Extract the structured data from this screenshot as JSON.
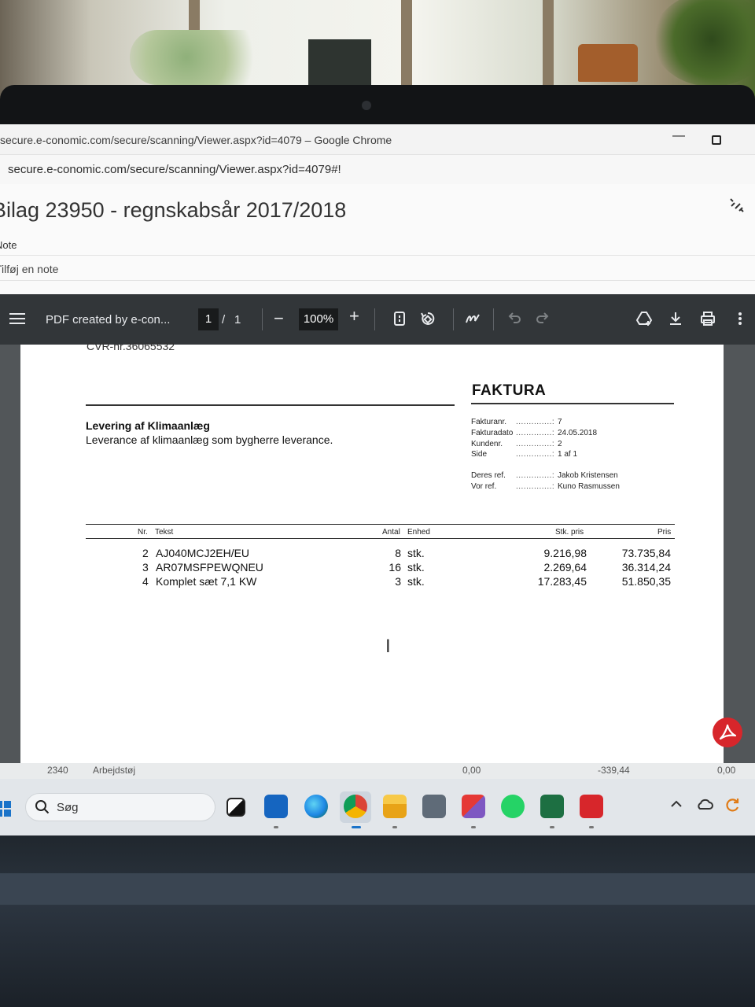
{
  "browser": {
    "window_title": "secure.e-conomic.com/secure/scanning/Viewer.aspx?id=4079 – Google Chrome",
    "url": "secure.e-conomic.com/secure/scanning/Viewer.aspx?id=4079#!"
  },
  "page": {
    "title": "Bilag 23950 - regnskabsår 2017/2018",
    "note_tab": "Note",
    "add_note": "Tilføj en note"
  },
  "pdf_toolbar": {
    "filename": "PDF created by e-con...",
    "current_page": "1",
    "page_separator": "/",
    "total_pages": "1",
    "zoom_out": "−",
    "zoom": "100%",
    "zoom_in": "+"
  },
  "invoice": {
    "cvr": "CVR-nr.36065532",
    "heading": "FAKTURA",
    "subject_title": "Levering af Klimaanlæg",
    "subject_description": "Leverance af klimaanlæg som bygherre leverance.",
    "meta": [
      {
        "label": "Fakturanr.",
        "value": "7"
      },
      {
        "label": "Fakturadato",
        "value": "24.05.2018"
      },
      {
        "label": "Kundenr.",
        "value": "2"
      },
      {
        "label": "Side",
        "value": "1 af 1"
      },
      {
        "label": "Deres ref.",
        "value": "Jakob Kristensen"
      },
      {
        "label": "Vor ref.",
        "value": "Kuno Rasmussen"
      }
    ],
    "columns": {
      "nr": "Nr.",
      "text": "Tekst",
      "qty": "Antal",
      "unit": "Enhed",
      "unit_price": "Stk. pris",
      "price": "Pris"
    },
    "lines": [
      {
        "nr": "2",
        "text": "AJ040MCJ2EH/EU",
        "qty": "8",
        "unit": "stk.",
        "unit_price": "9.216,98",
        "price": "73.735,84"
      },
      {
        "nr": "3",
        "text": "AR07MSFPEWQNEU",
        "qty": "16",
        "unit": "stk.",
        "unit_price": "2.269,64",
        "price": "36.314,24"
      },
      {
        "nr": "4",
        "text": "Komplet sæt 7,1 KW",
        "qty": "3",
        "unit": "stk.",
        "unit_price": "17.283,45",
        "price": "51.850,35"
      }
    ]
  },
  "underlying_row": {
    "col1": "2340",
    "col2": "Arbejdstøj",
    "col3": "0,00",
    "col4": "-339,44",
    "col5": "0,00"
  },
  "taskbar": {
    "search_placeholder": "Søg",
    "apps": [
      "task-view",
      "outlook",
      "edge",
      "chrome",
      "file-explorer",
      "calculator",
      "snipping-tool",
      "whatsapp",
      "excel",
      "acrobat"
    ]
  },
  "colors": {
    "pdf_toolbar": "#323639",
    "pdf_background": "#525659",
    "adobe_red": "#d7262b",
    "taskbar": "#e2e6ea"
  }
}
